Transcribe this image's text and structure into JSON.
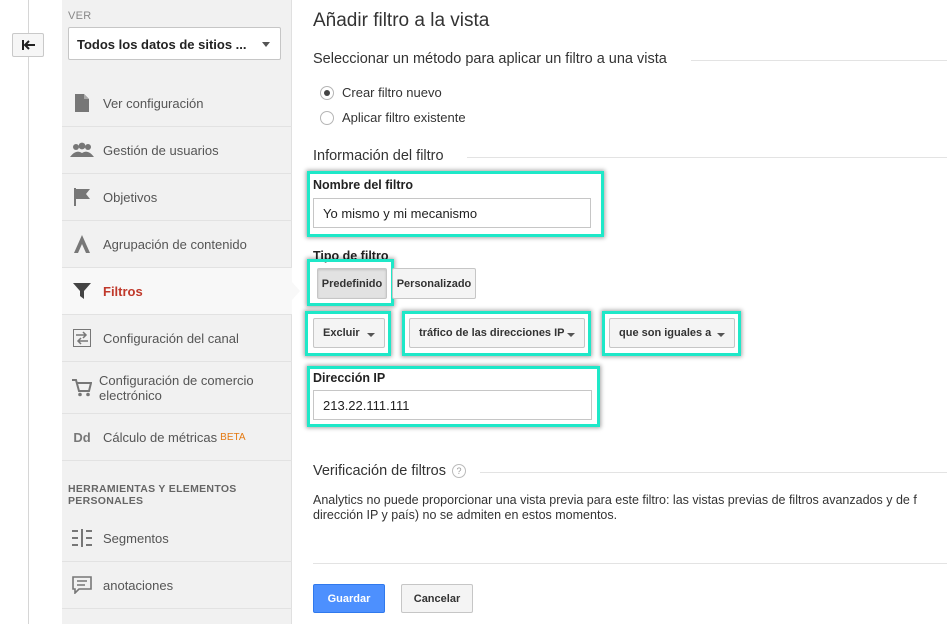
{
  "sidebar": {
    "ver_label": "VER",
    "view_selected": "Todos los datos de sitios ...",
    "items": [
      {
        "label": "Ver configuración",
        "icon": "document-icon"
      },
      {
        "label": "Gestión de usuarios",
        "icon": "users-icon"
      },
      {
        "label": "Objetivos",
        "icon": "flag-icon"
      },
      {
        "label": "Agrupación de contenido",
        "icon": "content-grouping-icon"
      },
      {
        "label": "Filtros",
        "icon": "filter-icon",
        "active": true
      },
      {
        "label": "Configuración del canal",
        "icon": "channel-settings-icon"
      },
      {
        "label": "Configuración de comercio electrónico",
        "icon": "cart-icon"
      },
      {
        "label": "Cálculo de métricas",
        "badge": "BETA",
        "icon": "dd-icon",
        "icon_text": "Dd"
      }
    ],
    "section_header": "HERRAMIENTAS Y ELEMENTOS PERSONALES",
    "items2": [
      {
        "label": "Segmentos",
        "icon": "segments-icon"
      },
      {
        "label": "anotaciones",
        "icon": "annotations-icon"
      }
    ]
  },
  "main": {
    "title": "Añadir filtro a la vista",
    "method_section": "Seleccionar un método para aplicar un filtro a una vista",
    "radio_new": "Crear filtro nuevo",
    "radio_existing": "Aplicar filtro existente",
    "info_section": "Información del filtro",
    "name_label": "Nombre del filtro",
    "name_value": "Yo mismo y mi mecanismo",
    "type_label": "Tipo de filtro",
    "type_predefined": "Predefinido",
    "type_custom": "Personalizado",
    "dropdown_action": "Excluir",
    "dropdown_source": "tráfico de las direcciones IP",
    "dropdown_expression": "que son iguales a",
    "ip_label": "Dirección IP",
    "ip_value": "213.22.111.111",
    "verify_section": "Verificación de filtros",
    "help_glyph": "?",
    "note_line1": "Analytics no puede proporcionar una vista previa para este filtro: las vistas previas de filtros avanzados y de f",
    "note_line2": "dirección IP y país) no se admiten en estos momentos.",
    "save_label": "Guardar",
    "cancel_label": "Cancelar"
  },
  "colors": {
    "highlight": "#1ee8c8",
    "active_nav": "#c0392b",
    "save_button": "#4d90fe",
    "beta_badge": "#e47911"
  }
}
